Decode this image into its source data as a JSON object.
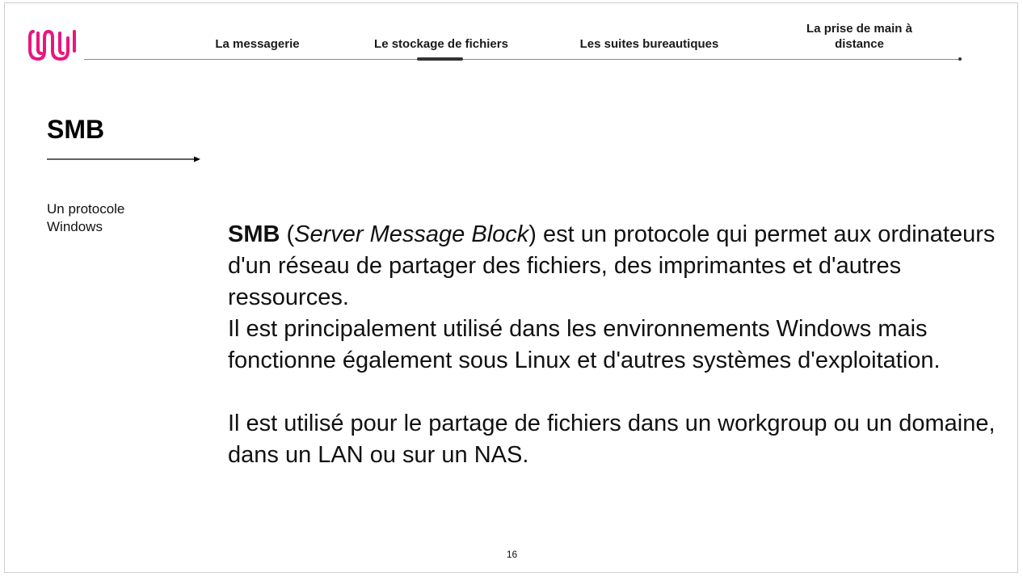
{
  "colors": {
    "accent": "#e8177e",
    "nav_line": "#8a8a8a",
    "indicator": "#333333"
  },
  "logo": {
    "icon": "brand-logo"
  },
  "nav": {
    "items": [
      {
        "label": "La messagerie"
      },
      {
        "label": "Le stockage de fichiers",
        "active": true
      },
      {
        "label": "Les suites bureautiques"
      },
      {
        "label_line1": "La prise de main à",
        "label_line2": "distance"
      }
    ]
  },
  "slide": {
    "title": "SMB",
    "side_label_line1": "Un protocole",
    "side_label_line2": "Windows",
    "body": {
      "p1_bold": "SMB",
      "p1_open_paren": " (",
      "p1_italic": "Server Message Block",
      "p1_rest": ") est un protocole qui permet aux ordinateurs d'un réseau de partager des fichiers, des imprimantes et d'autres ressources.",
      "p1_line2": "Il est principalement utilisé dans les environnements Windows mais fonctionne également sous Linux et d'autres systèmes d'exploitation.",
      "p2": "Il est utilisé pour le partage de fichiers dans un workgroup ou un domaine, dans un LAN ou sur un NAS."
    },
    "page_number": "16"
  }
}
